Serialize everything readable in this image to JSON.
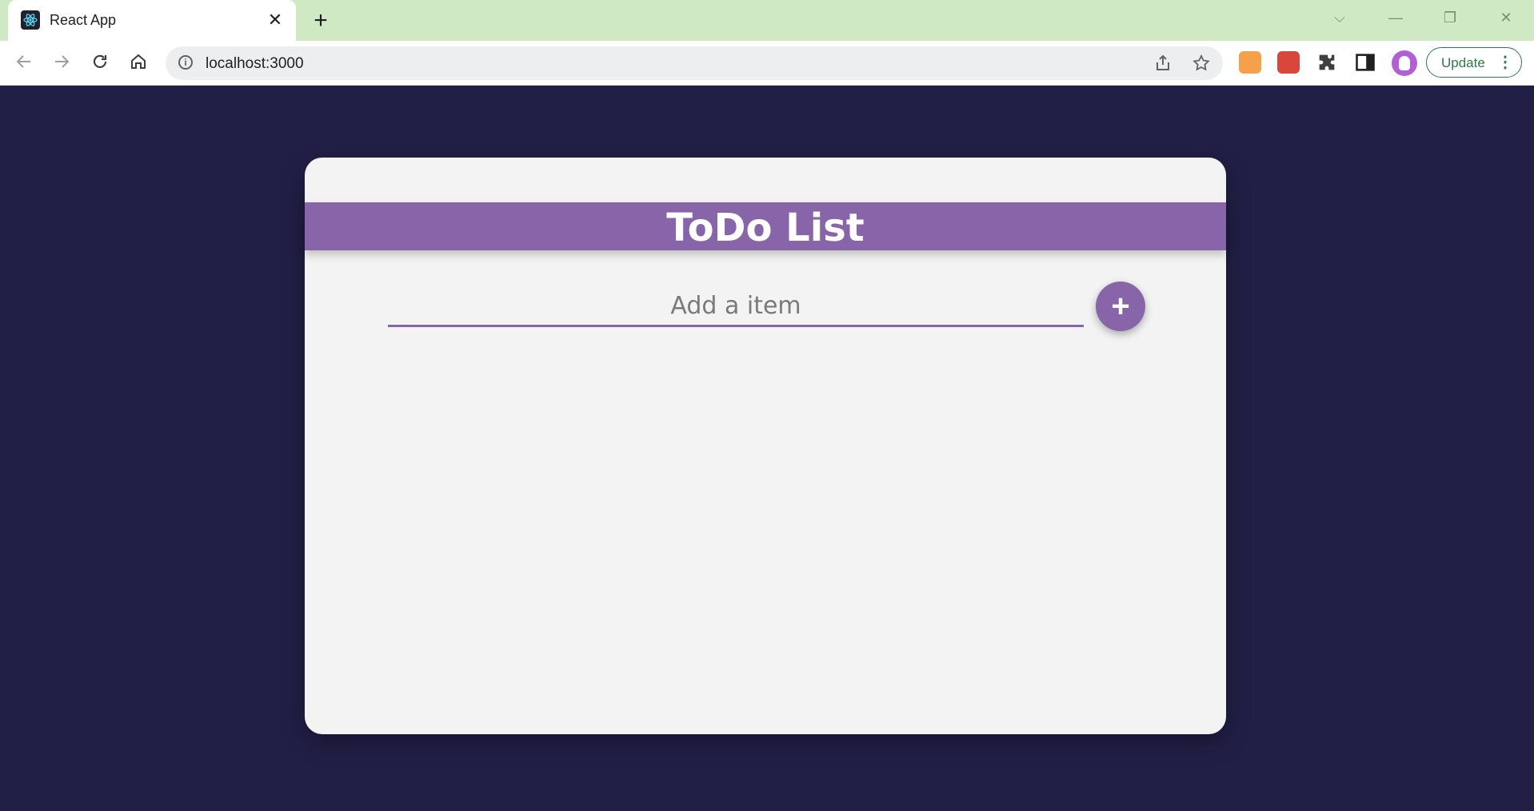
{
  "browser": {
    "tab_title": "React App",
    "tab_close_glyph": "✕",
    "new_tab_glyph": "+",
    "url": "localhost:3000",
    "update_label": "Update",
    "window_controls": {
      "dropdown": "⌵",
      "minimize": "—",
      "restore": "❐",
      "close": "✕"
    },
    "icons": [
      "back-icon",
      "forward-icon",
      "reload-icon",
      "home-icon",
      "info-icon",
      "share-icon",
      "star-icon",
      "metamask-icon",
      "extension-red-icon",
      "puzzle-icon",
      "side-panel-icon",
      "profile-avatar",
      "more-vert-icon"
    ]
  },
  "app": {
    "title": "ToDo List",
    "input_placeholder": "Add a item",
    "add_button_glyph": "+"
  },
  "colors": {
    "page_background": "#221f47",
    "card_background": "#f3f3f4",
    "accent_purple": "#8765a8",
    "tabstrip": "#cfe9c5"
  }
}
